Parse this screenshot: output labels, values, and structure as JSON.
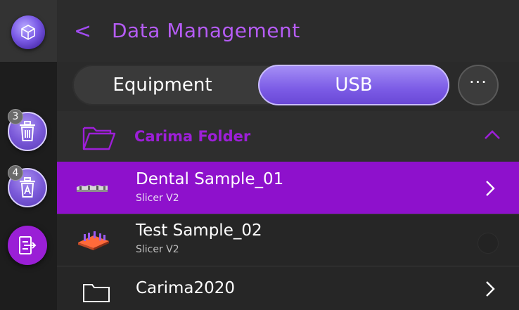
{
  "header": {
    "back_glyph": "<",
    "title": "Data Management"
  },
  "tabs": [
    {
      "label": "Equipment",
      "selected": false
    },
    {
      "label": "USB",
      "selected": true
    }
  ],
  "more_glyph": "···",
  "sidebar": {
    "logo_icon": "cube-icon",
    "buttons": [
      {
        "name": "delete-button",
        "badge": "3",
        "icon": "trash-icon"
      },
      {
        "name": "delete-all-button",
        "badge": "4",
        "icon": "trash-a-icon"
      },
      {
        "name": "export-button",
        "icon": "export-icon"
      }
    ]
  },
  "list": {
    "group": {
      "label": "Carima Folder",
      "expanded": true
    },
    "items": [
      {
        "title": "Dental Sample_01",
        "subtitle": "Slicer V2",
        "selected": true
      },
      {
        "title": "Test Sample_02",
        "subtitle": "Slicer V2",
        "selected": false
      }
    ],
    "folder": {
      "label": "Carima2020"
    }
  },
  "colors": {
    "accent_purple": "#8e11cc",
    "title_purple": "#b55cf5",
    "usb_tab": "#7c5ce6",
    "background": "#242424"
  }
}
